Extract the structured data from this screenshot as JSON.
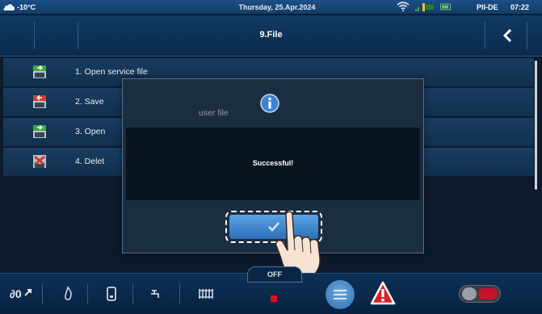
{
  "status_bar": {
    "temperature": "-10°C",
    "date": "Thursday, 25.Apr.2024",
    "language": "PII-DE",
    "time": "07:22",
    "icons": [
      "snowflake-cloud-icon",
      "wifi-icon",
      "signal-icon",
      "battery-icon"
    ]
  },
  "header": {
    "title": "9.File",
    "back_icon": "chevron-left-icon"
  },
  "list": {
    "items": [
      {
        "label": "1. Open service file",
        "icon": "file-open-green-icon"
      },
      {
        "label": "2. Save",
        "icon": "file-save-red-icon"
      },
      {
        "label": "3. Open",
        "icon": "file-open-green-icon"
      },
      {
        "label": "4. Delet",
        "icon": "file-delete-red-icon"
      }
    ]
  },
  "dialog": {
    "icon": "info-icon",
    "ghost_text": "user file",
    "message": "Successful!",
    "ok_icon": "checkmark-icon"
  },
  "toolbar": {
    "power_label": "OFF",
    "buttons": [
      "mode-icon",
      "flame-icon",
      "boiler-icon",
      "tap-icon",
      "radiator-icon",
      "menu-icon",
      "alarm-icon",
      "toggle-switch"
    ]
  },
  "colors": {
    "accent": "#2c6fb7",
    "status_red": "#e0101e",
    "background": "#0c1a2b"
  }
}
